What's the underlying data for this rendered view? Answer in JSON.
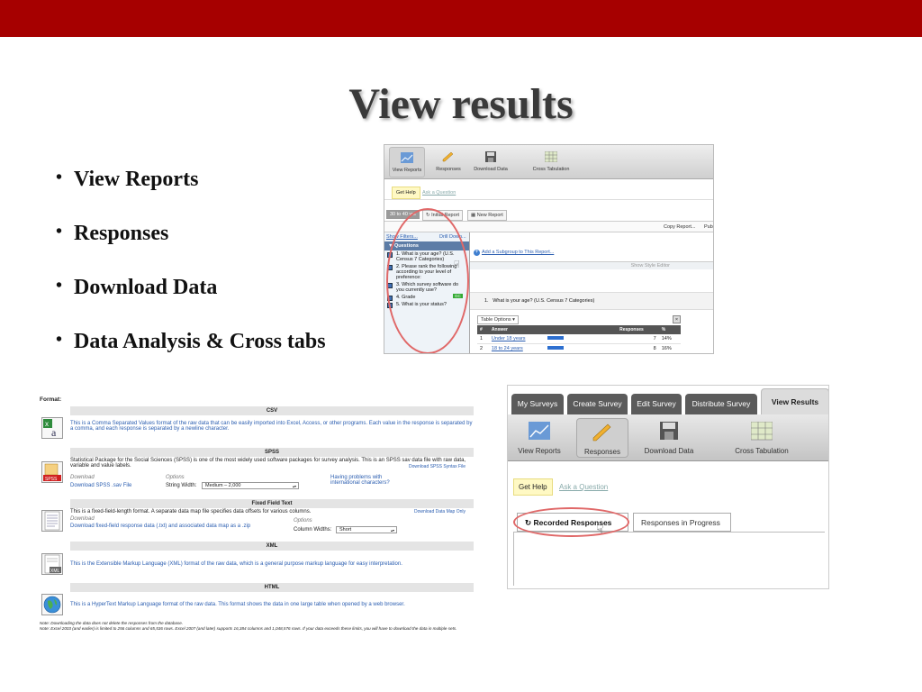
{
  "slide": {
    "title": "View results",
    "bullets": [
      "View Reports",
      "Responses",
      "Download Data",
      "Data Analysis & Cross tabs"
    ]
  },
  "reports_shot": {
    "toolbar": [
      "View Reports",
      "Responses",
      "Download Data",
      "Cross Tabulation"
    ],
    "get_help": "Get Help",
    "ask_question": "Ask a Question",
    "filter_pill": "30 to 40 yrs",
    "tabs": [
      "Initial Report",
      "New Report"
    ],
    "copy_report": "Copy Report...",
    "publish": "Pub",
    "show_filters": "Show Filters...",
    "drill_down": "Drill Down...",
    "questions_header": "Questions",
    "questions": [
      "1. What is your age? (U.S. Census 7 Categories)",
      "2. Please rank the following according to your level of preference:",
      "3. Which survey software do you currently use?",
      "4. Grade",
      "5. What is your status?"
    ],
    "grade_badge": "GC",
    "add_subgroup": "Add a Subgroup to This Report...",
    "show_style_editor": "Show Style Editor",
    "question_row": "What is your age? (U.S. Census 7 Categories)",
    "question_num": "1.",
    "table_options": "Table Options",
    "table_headers": [
      "#",
      "Answer",
      "Responses",
      "%"
    ],
    "table_rows": [
      {
        "num": "1",
        "answer": "Under 18 years",
        "responses": "7",
        "pct": "14%",
        "bar": 0.18
      },
      {
        "num": "2",
        "answer": "18 to 24 years",
        "responses": "8",
        "pct": "16%",
        "bar": 0.18
      }
    ]
  },
  "download_shot": {
    "format_label": "Format:",
    "csv": {
      "header": "CSV",
      "desc": "This is a Comma Separated Values format of the raw data that can be easily imported into Excel, Access, or other programs. Each value in the response is separated by a comma, and each response is separated by a newline character."
    },
    "spss": {
      "header": "SPSS",
      "desc": "Statistical Package for the Social Sciences (SPSS) is one of the most widely used software packages for survey analysis. This is an SPSS sav data file with raw data, variable and value labels.",
      "syntax_link": "Download SPSS Syntax File",
      "download_label": "Download",
      "download_link": "Download SPSS .sav File",
      "options_label": "Options",
      "string_width_label": "String Width:",
      "string_width_value": "Medium – 2,000",
      "problems_link": "Having problems with international characters?"
    },
    "fixed": {
      "header": "Fixed Field Text",
      "desc": "This is a fixed-field-length format. A separate data map file specifies data offsets for various columns.",
      "map_link": "Download Data Map Only",
      "download_label": "Download",
      "download_link": "Download fixed-field response data (.txt) and associated data map as a .zip",
      "options_label": "Options",
      "column_widths_label": "Column Widths:",
      "column_widths_value": "Short"
    },
    "xml": {
      "header": "XML",
      "desc": "This is the Extensible Markup Language (XML) format of the raw data, which is a general purpose markup language for easy interpretation."
    },
    "html": {
      "header": "HTML",
      "desc": "This is a HyperText Markup Language format of the raw data. This format shows the data in one large table when opened by a web browser."
    },
    "note1": "Note: Downloading the data does not delete the responses from the database.",
    "note2": "Note: Excel 2003 (and earlier) is limited to 256 columns and 65,536 rows. Excel 2007 (and later) supports 16,384 columns and 1,048,576 rows. If your data exceeds these limits, you will have to download the data in multiple sets."
  },
  "responses_shot": {
    "nav_tabs": [
      "My Surveys",
      "Create Survey",
      "Edit Survey",
      "Distribute Survey",
      "View Results"
    ],
    "toolbar": [
      "View Reports",
      "Responses",
      "Download Data",
      "Cross Tabulation"
    ],
    "get_help": "Get Help",
    "ask_question": "Ask a Question",
    "response_tabs": [
      "Recorded Responses",
      "Responses in Progress"
    ]
  },
  "colors": {
    "accent_bar": "#a60000",
    "highlight_oval": "#e06868",
    "link": "#2a5db0"
  }
}
